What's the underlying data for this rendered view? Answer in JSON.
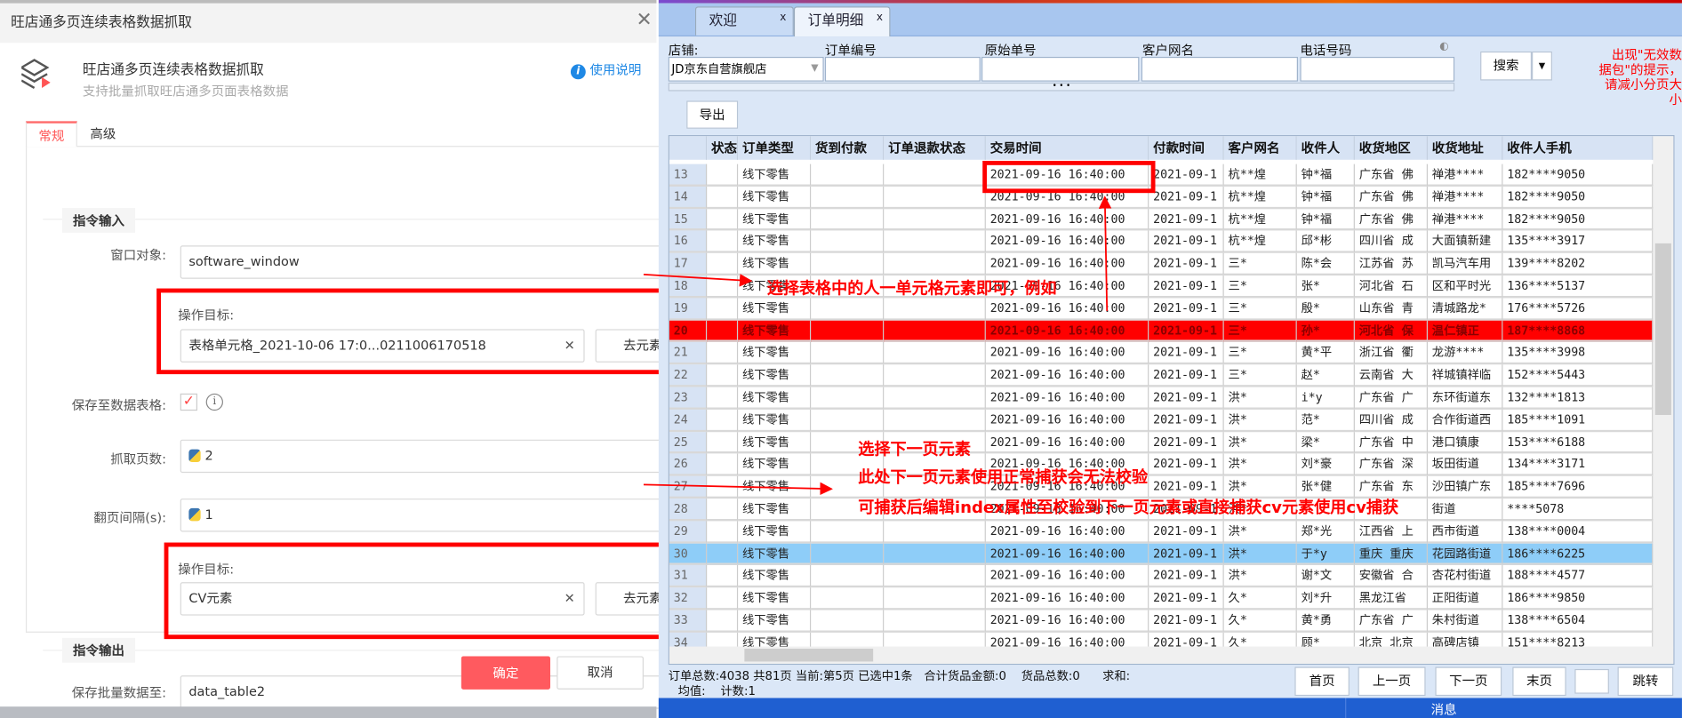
{
  "dialog": {
    "title": "旺店通多页连续表格数据抓取",
    "close_icon": "close-icon",
    "header_title": "旺店通多页连续表格数据抓取",
    "header_subtitle": "支持批量抓取旺店通多页面表格数据",
    "help_label": "使用说明",
    "tabs": [
      {
        "label": "常规",
        "active": true
      },
      {
        "label": "高级",
        "active": false
      }
    ],
    "section_input": "指令输入",
    "window_label": "窗口对象:",
    "window_value": "software_window",
    "target1_label": "操作目标:",
    "target1_value": "表格单元格_2021-10-06 17:0...0211006170518",
    "pick_label": "去元素库选择",
    "save_table_label": "保存至数据表格:",
    "save_table_checked": true,
    "pages_label": "抓取页数:",
    "pages_value": "2",
    "interval_label": "翻页间隔(s):",
    "interval_value": "1",
    "target2_label": "操作目标:",
    "target2_value": "CV元素",
    "section_output": "指令输出",
    "output_label": "保存批量数据至:",
    "output_value": "data_table2",
    "fx": "fx",
    "info": "i",
    "ok_label": "确定",
    "cancel_label": "取消",
    "accent": "#ff5a5f"
  },
  "app": {
    "tabs": [
      {
        "label": "欢迎",
        "close": "x"
      },
      {
        "label": "订单明细",
        "close": "x",
        "active": true
      }
    ],
    "filters": {
      "shop_label": "店铺:",
      "shop_value": "JD京东自营旗舰店",
      "order_no_label": "订单编号",
      "orig_no_label": "原始单号",
      "customer_label": "客户网名",
      "phone_label": "电话号码",
      "more": "• • •"
    },
    "search_label": "搜索",
    "export_label": "导出",
    "notice": [
      "出现\"无效数",
      "据包\"的提示，",
      "请减小分页大小"
    ],
    "columns": [
      "状态",
      "订单类型",
      "货到付款",
      "订单退款状态",
      "交易时间",
      "付款时间",
      "客户网名",
      "收件人",
      "收货地区",
      "收货地址",
      "收件人手机"
    ],
    "rows": [
      [
        "13",
        "",
        "线下零售",
        "",
        "",
        "2021-09-16 16:40:00",
        "2021-09-1",
        "杭**煌",
        "钟*福",
        "广东省 佛",
        "禅港****",
        "182****9050"
      ],
      [
        "14",
        "",
        "线下零售",
        "",
        "",
        "2021-09-16 16:40:00",
        "2021-09-1",
        "杭**煌",
        "钟*福",
        "广东省 佛",
        "禅港****",
        "182****9050"
      ],
      [
        "15",
        "",
        "线下零售",
        "",
        "",
        "2021-09-16 16:40:00",
        "2021-09-1",
        "杭**煌",
        "钟*福",
        "广东省 佛",
        "禅港****",
        "182****9050"
      ],
      [
        "16",
        "",
        "线下零售",
        "",
        "",
        "2021-09-16 16:40:00",
        "2021-09-1",
        "杭**煌",
        "邱*彬",
        "四川省 成",
        "大面镇新建",
        "135****3917"
      ],
      [
        "17",
        "",
        "线下零售",
        "",
        "",
        "2021-09-16 16:40:00",
        "2021-09-1",
        "三*",
        "陈*会",
        "江苏省 苏",
        "凯马汽车用",
        "139****8202"
      ],
      [
        "18",
        "",
        "线下零售",
        "",
        "",
        "2021-09-16 16:40:00",
        "2021-09-1",
        "三*",
        "张*",
        "河北省 石",
        "区和平时光",
        "136****5137"
      ],
      [
        "19",
        "",
        "线下零售",
        "",
        "",
        "2021-09-16 16:40:00",
        "2021-09-1",
        "三*",
        "殷*",
        "山东省 青",
        "清城路龙*",
        "176****5726"
      ],
      [
        "20",
        "",
        "线下零售",
        "",
        "",
        "2021-09-16 16:40:00",
        "2021-09-1",
        "三*",
        "孙*",
        "河北省 保",
        "温仁镇正",
        "187****8868"
      ],
      [
        "21",
        "",
        "线下零售",
        "",
        "",
        "2021-09-16 16:40:00",
        "2021-09-1",
        "三*",
        "黄*平",
        "浙江省 衢",
        "龙游****",
        "135****3998"
      ],
      [
        "22",
        "",
        "线下零售",
        "",
        "",
        "2021-09-16 16:40:00",
        "2021-09-1",
        "三*",
        "赵*",
        "云南省 大",
        "祥城镇祥临",
        "152****5443"
      ],
      [
        "23",
        "",
        "线下零售",
        "",
        "",
        "2021-09-16 16:40:00",
        "2021-09-1",
        "洪*",
        "i*y",
        "广东省 广",
        "东环街道东",
        "132****1813"
      ],
      [
        "24",
        "",
        "线下零售",
        "",
        "",
        "2021-09-16 16:40:00",
        "2021-09-1",
        "洪*",
        "范*",
        "四川省 成",
        "合作街道西",
        "185****1091"
      ],
      [
        "25",
        "",
        "线下零售",
        "",
        "",
        "2021-09-16 16:40:00",
        "2021-09-1",
        "洪*",
        "梁*",
        "广东省 中",
        "港口镇康",
        "153****6188"
      ],
      [
        "26",
        "",
        "线下零售",
        "",
        "",
        "2021-09-16 16:40:00",
        "2021-09-1",
        "洪*",
        "刘*豪",
        "广东省 深",
        "坂田街道",
        "134****3171"
      ],
      [
        "27",
        "",
        "线下零售",
        "",
        "",
        "2021-09-16 16:40:00",
        "2021-09-1",
        "洪*",
        "张*健",
        "广东省 东",
        "沙田镇广东",
        "185****7696"
      ],
      [
        "28",
        "",
        "线下零售",
        "",
        "",
        "2021-09-16 16:40:00",
        "2021-09-1",
        "洪*",
        "",
        "",
        "街道",
        "****5078"
      ],
      [
        "29",
        "",
        "线下零售",
        "",
        "",
        "2021-09-16 16:40:00",
        "2021-09-1",
        "洪*",
        "郑*光",
        "江西省 上",
        "西市街道",
        "138****0004"
      ],
      [
        "30",
        "",
        "线下零售",
        "",
        "",
        "2021-09-16 16:40:00",
        "2021-09-1",
        "洪*",
        "于*y",
        "重庆 重庆",
        "花园路街道",
        "186****6225"
      ],
      [
        "31",
        "",
        "线下零售",
        "",
        "",
        "2021-09-16 16:40:00",
        "2021-09-1",
        "洪*",
        "谢*文",
        "安徽省 合",
        "杏花村街道",
        "188****4577"
      ],
      [
        "32",
        "",
        "线下零售",
        "",
        "",
        "2021-09-16 16:40:00",
        "2021-09-1",
        "久*",
        "刘*升",
        "黑龙江省",
        "正阳街道",
        "186****9850"
      ],
      [
        "33",
        "",
        "线下零售",
        "",
        "",
        "2021-09-16 16:40:00",
        "2021-09-1",
        "久*",
        "黄*勇",
        "广东省 广",
        "朱村街道",
        "138****6504"
      ],
      [
        "34",
        "",
        "线下零售",
        "",
        "",
        "2021-09-16 16:40:00",
        "2021-09-1",
        "久*",
        "顾*",
        "北京 北京",
        "高碑店镇",
        "151****8213"
      ]
    ],
    "highlight_row": "20",
    "selected_row": "30",
    "status_line1": "订单总数:4038 共81页 当前:第5页 已选中1条   合计货品金额:0    货品总数:0      求和:",
    "status_line2": "均值:    计数:1",
    "pager": {
      "first": "首页",
      "prev": "上一页",
      "next": "下一页",
      "last": "末页",
      "page_input": "",
      "jump": "跳转"
    },
    "message_label": "消息"
  },
  "annotations": {
    "cell_hint": "选择表格中的人一单元格元素即可，例如",
    "next_hint": [
      "选择下一页元素",
      "此处下一页元素使用正常捕获会无法校验",
      "可捕获后编辑index属性至校验到下一页元素或直接捕获cv元素使用cv捕获"
    ]
  }
}
